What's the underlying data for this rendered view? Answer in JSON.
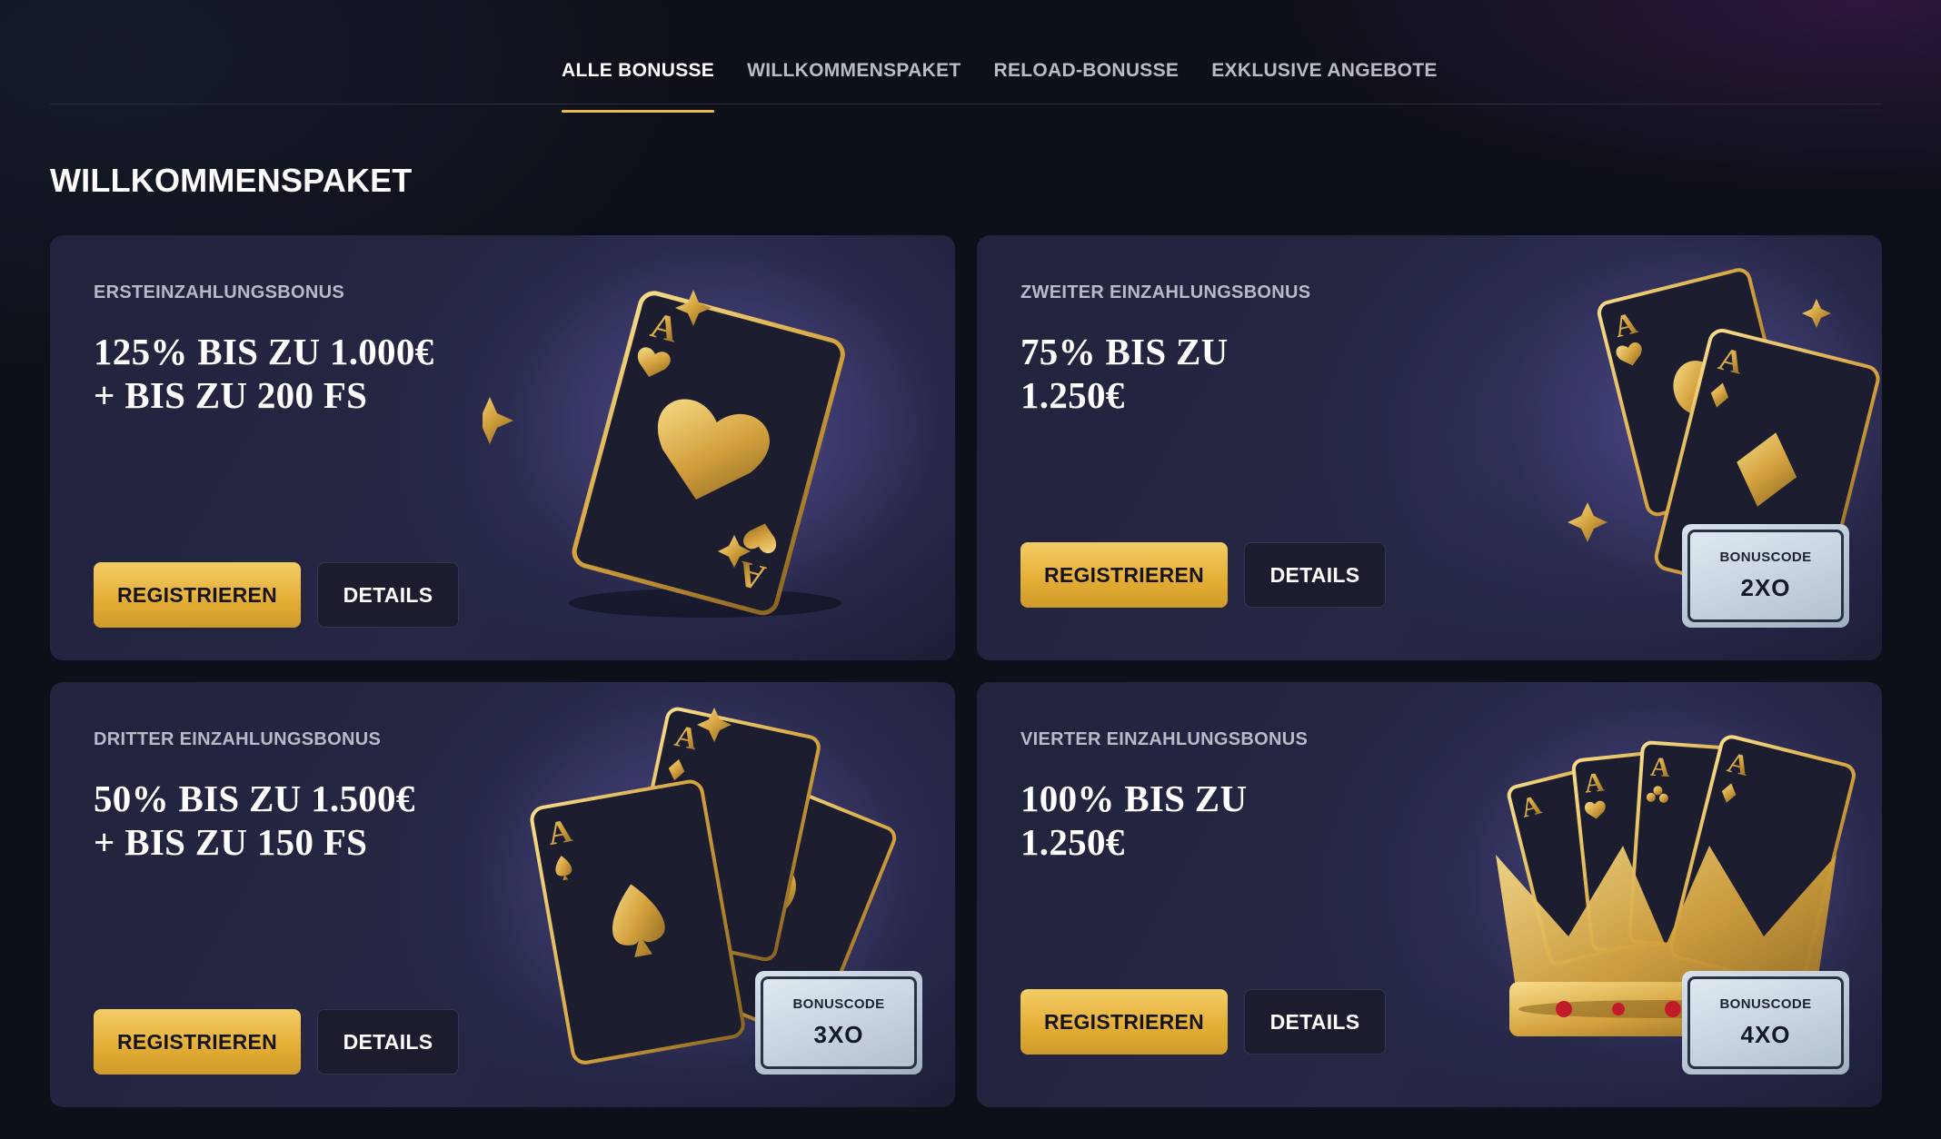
{
  "tabs": [
    {
      "label": "ALLE BONUSSE",
      "active": true
    },
    {
      "label": "WILLKOMMENSPAKET",
      "active": false
    },
    {
      "label": "RELOAD-BONUSSE",
      "active": false
    },
    {
      "label": "EXKLUSIVE ANGEBOTE",
      "active": false
    }
  ],
  "section_title": "WILLKOMMENSPAKET",
  "colors": {
    "accent": "#f0b84a",
    "card_bg": "#23243f",
    "page_bg": "#0e1019"
  },
  "cards": [
    {
      "kicker": "ERSTEINZAHLUNGSBONUS",
      "headline": [
        "125% BIS ZU 1.000€",
        "+ BIS ZU 200 FS"
      ],
      "primary_label": "REGISTRIEREN",
      "secondary_label": "DETAILS",
      "art": "ace-of-hearts-card-icon"
    },
    {
      "kicker": "ZWEITER EINZAHLUNGSBONUS",
      "headline": [
        "75% BIS ZU",
        "1.250€"
      ],
      "primary_label": "REGISTRIEREN",
      "secondary_label": "DETAILS",
      "art": "two-aces-cards-icon",
      "code_label": "BONUSCODE",
      "code_value": "2XO"
    },
    {
      "kicker": "DRITTER EINZAHLUNGSBONUS",
      "headline": [
        "50% BIS ZU 1.500€",
        "+ BIS ZU 150 FS"
      ],
      "primary_label": "REGISTRIEREN",
      "secondary_label": "DETAILS",
      "art": "three-aces-cards-icon",
      "code_label": "BONUSCODE",
      "code_value": "3XO"
    },
    {
      "kicker": "VIERTER EINZAHLUNGSBONUS",
      "headline": [
        "100% BIS ZU",
        "1.250€"
      ],
      "primary_label": "REGISTRIEREN",
      "secondary_label": "DETAILS",
      "art": "crown-with-four-aces-icon",
      "code_label": "BONUSCODE",
      "code_value": "4XO"
    }
  ]
}
